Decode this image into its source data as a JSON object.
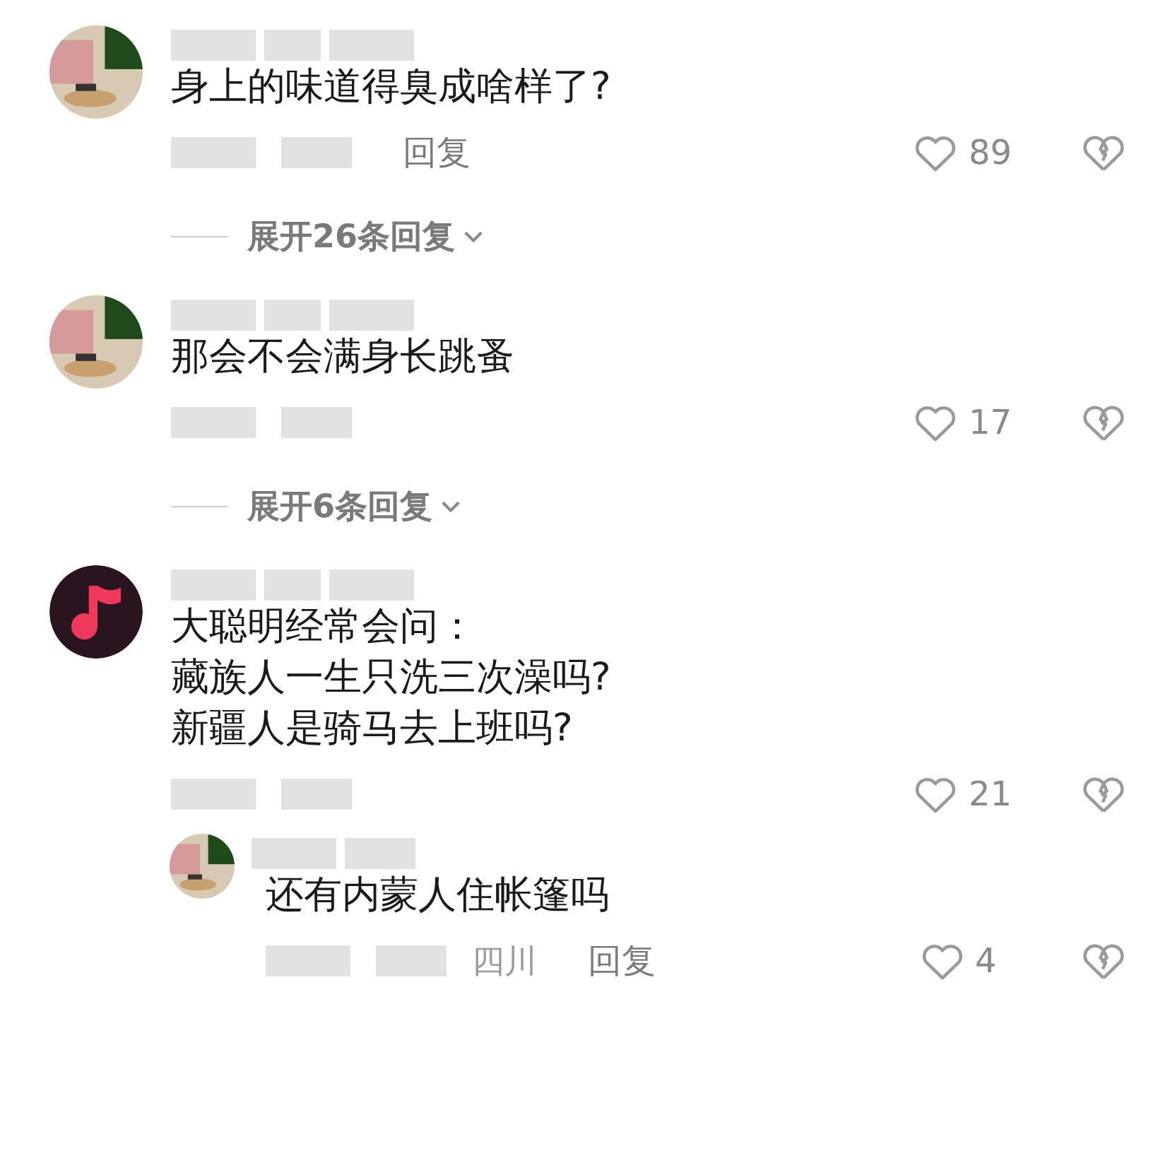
{
  "comments": [
    {
      "username_hidden": true,
      "text_lines": [
        "身上的味道得臭成啥样了?"
      ],
      "meta_hidden": true,
      "reply_label": "回复",
      "likes": "89",
      "expand": "展开26条回复"
    },
    {
      "username_hidden": true,
      "text_lines": [
        "那会不会满身长跳蚤"
      ],
      "meta_hidden": true,
      "likes": "17",
      "expand": "展开6条回复"
    },
    {
      "avatar": {
        "kind": "music-note"
      },
      "username_hidden": true,
      "text_lines": [
        "大聪明经常会问：",
        "藏族人一生只洗三次澡吗?",
        "新疆人是骑马去上班吗?"
      ],
      "meta_hidden": true,
      "likes": "21",
      "replies": [
        {
          "username_hidden": true,
          "text_lines": [
            "还有内蒙人住帐篷吗"
          ],
          "meta_hidden": true,
          "location": "四川",
          "reply_label": "回复",
          "likes": "4"
        }
      ]
    }
  ]
}
